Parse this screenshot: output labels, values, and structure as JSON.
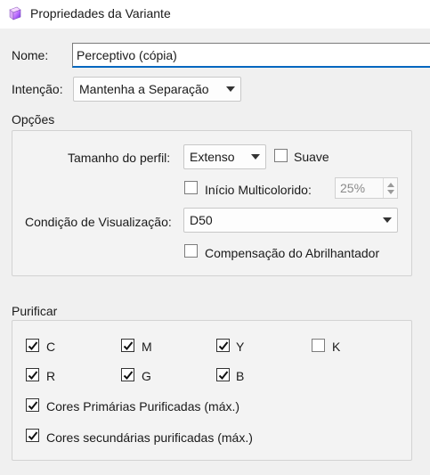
{
  "window": {
    "title": "Propriedades da Variante",
    "icon": "color-profile-icon"
  },
  "name_field": {
    "label": "Nome:",
    "value": "Perceptivo (cópia)"
  },
  "intent": {
    "label": "Intenção:",
    "selected": "Mantenha a Separação"
  },
  "options": {
    "heading": "Opções",
    "profile_size": {
      "label": "Tamanho do perfil:",
      "selected": "Extenso"
    },
    "smooth": {
      "label": "Suave",
      "checked": false
    },
    "multicolor_start": {
      "label": "Início Multicolorido:",
      "checked": false,
      "value": "25%"
    },
    "viewing_condition": {
      "label": "Condição de Visualização:",
      "selected": "D50"
    },
    "brightener_compensation": {
      "label": "Compensação do Abrilhantador",
      "checked": false
    }
  },
  "purify": {
    "heading": "Purificar",
    "channels": [
      {
        "label": "C",
        "checked": true
      },
      {
        "label": "M",
        "checked": true
      },
      {
        "label": "Y",
        "checked": true
      },
      {
        "label": "K",
        "checked": false
      },
      {
        "label": "R",
        "checked": true
      },
      {
        "label": "G",
        "checked": true
      },
      {
        "label": "B",
        "checked": true
      }
    ],
    "primaries": {
      "label": "Cores Primárias Purificadas (máx.)",
      "checked": true
    },
    "secondaries": {
      "label": "Cores secundárias purificadas (máx.)",
      "checked": true
    }
  },
  "colors": {
    "accent": "#0067c0",
    "background": "#f0f0f0",
    "group_border": "#d2d2d2"
  }
}
